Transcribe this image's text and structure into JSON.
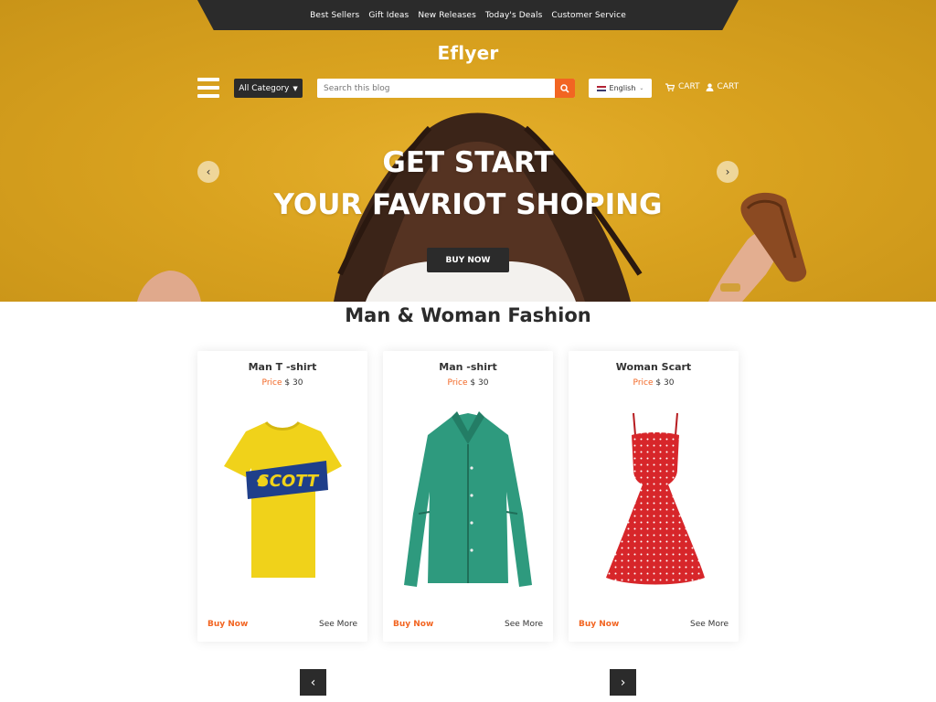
{
  "topnav": {
    "links": [
      "Best Sellers",
      "Gift Ideas",
      "New Releases",
      "Today's Deals",
      "Customer Service"
    ]
  },
  "brand": {
    "logo": "Eflyer"
  },
  "header": {
    "category_label": "All Category",
    "search_placeholder": "Search this blog",
    "language": "English",
    "cart_label_1": "CART",
    "cart_label_2": "CART"
  },
  "hero": {
    "line1": "GET START",
    "line2": "YOUR FAVRIOT SHOPING",
    "button": "BUY NOW"
  },
  "section": {
    "title": "Man & Woman Fashion"
  },
  "products": [
    {
      "name": "Man T -shirt",
      "price_label": "Price",
      "price": "$ 30",
      "buy": "Buy Now",
      "more": "See More"
    },
    {
      "name": "Man -shirt",
      "price_label": "Price",
      "price": "$ 30",
      "buy": "Buy Now",
      "more": "See More"
    },
    {
      "name": "Woman Scart",
      "price_label": "Price",
      "price": "$ 30",
      "buy": "Buy Now",
      "more": "See More"
    }
  ],
  "colors": {
    "accent": "#f26522",
    "dark": "#2b2b2b",
    "hero_bg": "#d9a21f"
  },
  "icons": {
    "menu": "hamburger-icon",
    "search": "search-icon",
    "cart": "cart-icon",
    "user": "user-icon",
    "slider_prev": "chevron-left-icon",
    "slider_next": "chevron-right-icon"
  }
}
